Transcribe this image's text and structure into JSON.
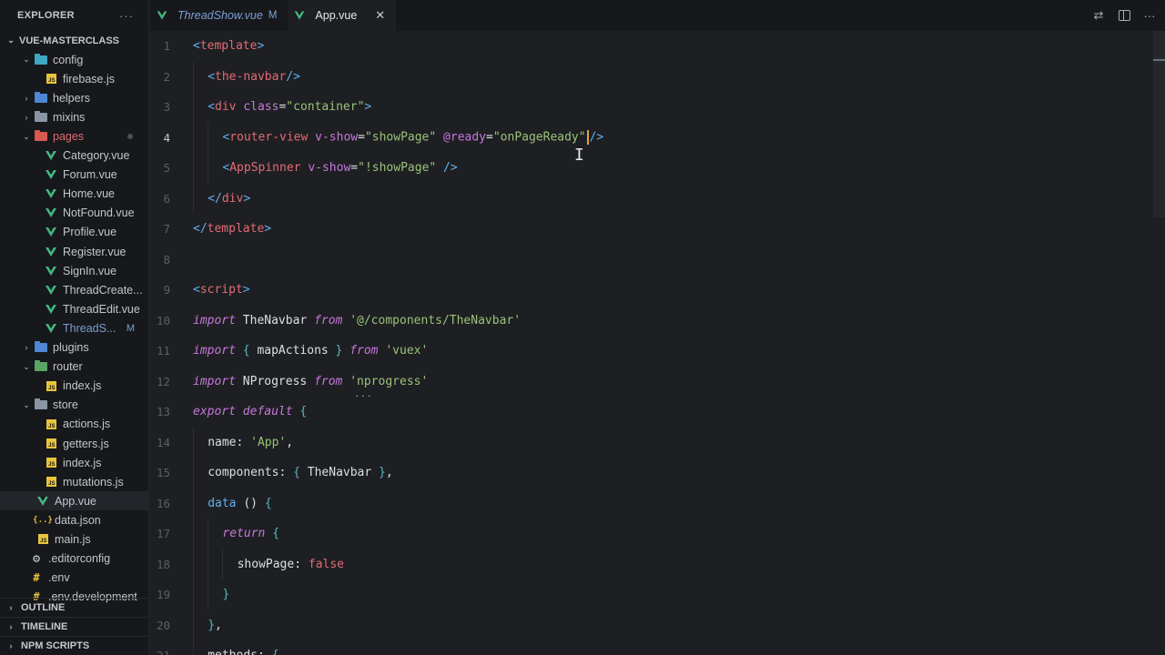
{
  "sidebar": {
    "title": "EXPLORER",
    "more": "···",
    "root": "VUE-MASTERCLASS",
    "items": [
      {
        "label": "config",
        "kind": "folder-teal",
        "depth": 1,
        "open": true
      },
      {
        "label": "firebase.js",
        "kind": "js",
        "depth": 2
      },
      {
        "label": "helpers",
        "kind": "folder-blue",
        "depth": 1,
        "open": false
      },
      {
        "label": "mixins",
        "kind": "folder",
        "depth": 1,
        "open": false
      },
      {
        "label": "pages",
        "kind": "folder-red",
        "depth": 1,
        "open": true,
        "dot": true
      },
      {
        "label": "Category.vue",
        "kind": "vue",
        "depth": 2
      },
      {
        "label": "Forum.vue",
        "kind": "vue",
        "depth": 2
      },
      {
        "label": "Home.vue",
        "kind": "vue",
        "depth": 2
      },
      {
        "label": "NotFound.vue",
        "kind": "vue",
        "depth": 2
      },
      {
        "label": "Profile.vue",
        "kind": "vue",
        "depth": 2
      },
      {
        "label": "Register.vue",
        "kind": "vue",
        "depth": 2
      },
      {
        "label": "SignIn.vue",
        "kind": "vue",
        "depth": 2
      },
      {
        "label": "ThreadCreate...",
        "kind": "vue",
        "depth": 2
      },
      {
        "label": "ThreadEdit.vue",
        "kind": "vue",
        "depth": 2
      },
      {
        "label": "ThreadS...",
        "kind": "vue",
        "depth": 2,
        "modified": true,
        "badge": "M"
      },
      {
        "label": "plugins",
        "kind": "folder-blue",
        "depth": 1,
        "open": false
      },
      {
        "label": "router",
        "kind": "folder-green",
        "depth": 1,
        "open": true
      },
      {
        "label": "index.js",
        "kind": "js",
        "depth": 2
      },
      {
        "label": "store",
        "kind": "folder",
        "depth": 1,
        "open": true
      },
      {
        "label": "actions.js",
        "kind": "js",
        "depth": 2
      },
      {
        "label": "getters.js",
        "kind": "js",
        "depth": 2
      },
      {
        "label": "index.js",
        "kind": "js",
        "depth": 2
      },
      {
        "label": "mutations.js",
        "kind": "js",
        "depth": 2
      },
      {
        "label": "App.vue",
        "kind": "vue",
        "depth": 1,
        "selected": true
      },
      {
        "label": "data.json",
        "kind": "json",
        "depth": 1
      },
      {
        "label": "main.js",
        "kind": "js",
        "depth": 1
      },
      {
        "label": ".editorconfig",
        "kind": "cfg",
        "depth": 0
      },
      {
        "label": ".env",
        "kind": "hash",
        "depth": 0
      },
      {
        "label": ".env.development",
        "kind": "hash",
        "depth": 0
      }
    ],
    "panels": [
      "OUTLINE",
      "TIMELINE",
      "NPM SCRIPTS"
    ]
  },
  "tabs": [
    {
      "label": "ThreadShow.vue",
      "badge": "M",
      "active": false
    },
    {
      "label": "App.vue",
      "close": "✕",
      "active": true
    }
  ],
  "editor": {
    "current_line": 4,
    "lines": [
      {
        "n": "1",
        "tokens": [
          [
            "tag",
            "<"
          ],
          [
            "tagp",
            "template"
          ],
          [
            "tag",
            ">"
          ]
        ],
        "indent": 0
      },
      {
        "n": "2",
        "tokens": [
          [
            "tag",
            "<"
          ],
          [
            "tagp",
            "the-navbar"
          ],
          [
            "tag",
            "/>"
          ]
        ],
        "indent": 1
      },
      {
        "n": "3",
        "tokens": [
          [
            "tag",
            "<"
          ],
          [
            "tagp",
            "div"
          ],
          [
            "plain",
            " "
          ],
          [
            "att",
            "class"
          ],
          [
            "plain",
            "="
          ],
          [
            "str",
            "\"container\""
          ],
          [
            "tag",
            ">"
          ]
        ],
        "indent": 1
      },
      {
        "n": "4",
        "tokens": [
          [
            "tag",
            "<"
          ],
          [
            "tagp",
            "router-view"
          ],
          [
            "plain",
            " "
          ],
          [
            "att",
            "v-show"
          ],
          [
            "plain",
            "="
          ],
          [
            "str",
            "\"showPage\""
          ],
          [
            "plain",
            " "
          ],
          [
            "att",
            "@ready"
          ],
          [
            "plain",
            "="
          ],
          [
            "str",
            "\"onPageReady\""
          ],
          [
            "cursor",
            ""
          ],
          [
            "tag",
            "/>"
          ]
        ],
        "indent": 2
      },
      {
        "n": "5",
        "tokens": [
          [
            "tag",
            "<"
          ],
          [
            "tagp",
            "AppSpinner"
          ],
          [
            "plain",
            " "
          ],
          [
            "att",
            "v-show"
          ],
          [
            "plain",
            "="
          ],
          [
            "str",
            "\"!showPage\""
          ],
          [
            "plain",
            " "
          ],
          [
            "tag",
            "/>"
          ]
        ],
        "indent": 2
      },
      {
        "n": "6",
        "tokens": [
          [
            "tag",
            "</"
          ],
          [
            "tagp",
            "div"
          ],
          [
            "tag",
            ">"
          ]
        ],
        "indent": 1
      },
      {
        "n": "7",
        "tokens": [
          [
            "tag",
            "</"
          ],
          [
            "tagp",
            "template"
          ],
          [
            "tag",
            ">"
          ]
        ],
        "indent": 0
      },
      {
        "n": "8",
        "tokens": [],
        "indent": 0
      },
      {
        "n": "9",
        "tokens": [
          [
            "tag",
            "<"
          ],
          [
            "tagp",
            "script"
          ],
          [
            "tag",
            ">"
          ]
        ],
        "indent": 0
      },
      {
        "n": "10",
        "tokens": [
          [
            "impkw",
            "import"
          ],
          [
            "plain",
            " TheNavbar "
          ],
          [
            "impkw",
            "from"
          ],
          [
            "plain",
            " "
          ],
          [
            "str",
            "'@/components/TheNavbar'"
          ]
        ],
        "indent": 0
      },
      {
        "n": "11",
        "tokens": [
          [
            "impkw",
            "import"
          ],
          [
            "plain",
            " "
          ],
          [
            "brace",
            "{"
          ],
          [
            "plain",
            " mapActions "
          ],
          [
            "brace",
            "}"
          ],
          [
            "plain",
            " "
          ],
          [
            "impkw",
            "from"
          ],
          [
            "plain",
            " "
          ],
          [
            "str",
            "'vuex'"
          ]
        ],
        "indent": 0
      },
      {
        "n": "12",
        "tokens": [
          [
            "impkw",
            "import"
          ],
          [
            "plain",
            " NProgress "
          ],
          [
            "impkw",
            "from"
          ],
          [
            "plain",
            " "
          ],
          [
            "str",
            "'nprogress'"
          ]
        ],
        "indent": 0
      },
      {
        "n": "13",
        "tokens": [
          [
            "impkw",
            "export"
          ],
          [
            "plain",
            " "
          ],
          [
            "impkw",
            "default"
          ],
          [
            "plain",
            " "
          ],
          [
            "brace",
            "{"
          ]
        ],
        "indent": 0
      },
      {
        "n": "14",
        "tokens": [
          [
            "plain",
            "name: "
          ],
          [
            "str",
            "'App'"
          ],
          [
            "plain",
            ","
          ]
        ],
        "indent": 1
      },
      {
        "n": "15",
        "tokens": [
          [
            "plain",
            "components: "
          ],
          [
            "brace",
            "{"
          ],
          [
            "plain",
            " TheNavbar "
          ],
          [
            "brace",
            "}"
          ],
          [
            "plain",
            ","
          ]
        ],
        "indent": 1
      },
      {
        "n": "16",
        "tokens": [
          [
            "fn",
            "data"
          ],
          [
            "plain",
            " () "
          ],
          [
            "brace",
            "{"
          ]
        ],
        "indent": 1
      },
      {
        "n": "17",
        "tokens": [
          [
            "impkw",
            "return"
          ],
          [
            "plain",
            " "
          ],
          [
            "brace",
            "{"
          ]
        ],
        "indent": 2
      },
      {
        "n": "18",
        "tokens": [
          [
            "plain",
            "showPage: "
          ],
          [
            "bool",
            "false"
          ]
        ],
        "indent": 3
      },
      {
        "n": "19",
        "tokens": [
          [
            "brace",
            "}"
          ]
        ],
        "indent": 2
      },
      {
        "n": "20",
        "tokens": [
          [
            "brace",
            "}"
          ],
          [
            "plain",
            ","
          ]
        ],
        "indent": 1
      },
      {
        "n": "21",
        "tokens": [
          [
            "plain",
            "methods: "
          ],
          [
            "brace",
            "{"
          ]
        ],
        "indent": 1
      }
    ],
    "fold_hint": "···"
  },
  "colors": {
    "accent": "#42b883",
    "modified": "#7a9fd6",
    "cursor": "#e5a33a"
  }
}
